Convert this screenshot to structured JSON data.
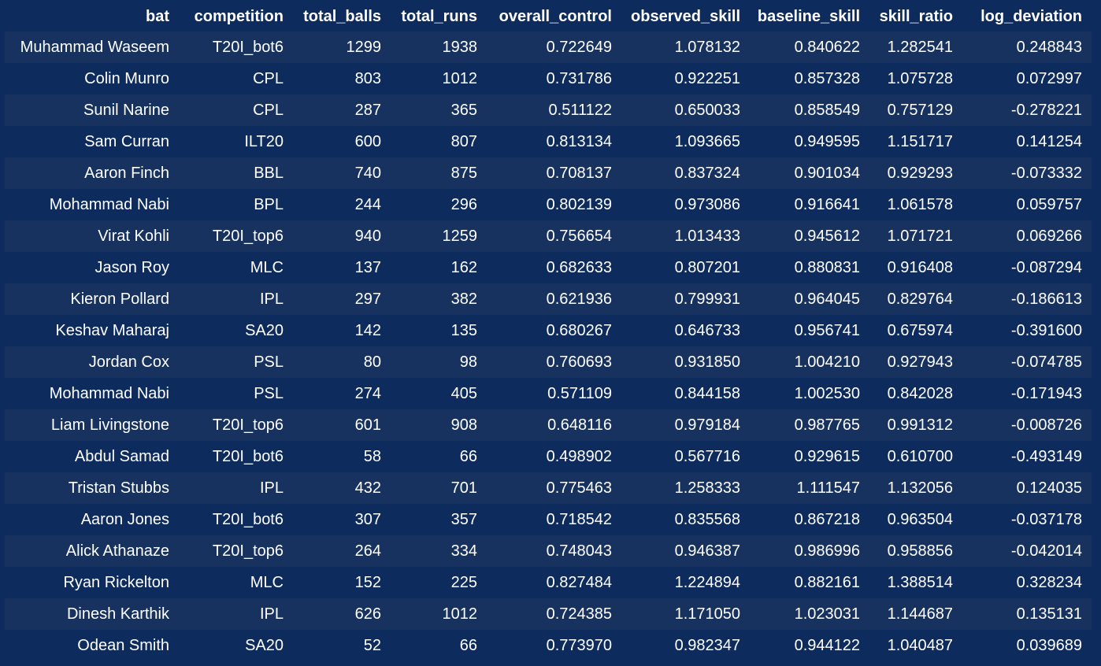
{
  "table": {
    "columns": [
      "bat",
      "competition",
      "total_balls",
      "total_runs",
      "overall_control",
      "observed_skill",
      "baseline_skill",
      "skill_ratio",
      "log_deviation"
    ],
    "rows": [
      [
        "Muhammad Waseem",
        "T20I_bot6",
        "1299",
        "1938",
        "0.722649",
        "1.078132",
        "0.840622",
        "1.282541",
        "0.248843"
      ],
      [
        "Colin Munro",
        "CPL",
        "803",
        "1012",
        "0.731786",
        "0.922251",
        "0.857328",
        "1.075728",
        "0.072997"
      ],
      [
        "Sunil Narine",
        "CPL",
        "287",
        "365",
        "0.511122",
        "0.650033",
        "0.858549",
        "0.757129",
        "-0.278221"
      ],
      [
        "Sam Curran",
        "ILT20",
        "600",
        "807",
        "0.813134",
        "1.093665",
        "0.949595",
        "1.151717",
        "0.141254"
      ],
      [
        "Aaron Finch",
        "BBL",
        "740",
        "875",
        "0.708137",
        "0.837324",
        "0.901034",
        "0.929293",
        "-0.073332"
      ],
      [
        "Mohammad Nabi",
        "BPL",
        "244",
        "296",
        "0.802139",
        "0.973086",
        "0.916641",
        "1.061578",
        "0.059757"
      ],
      [
        "Virat Kohli",
        "T20I_top6",
        "940",
        "1259",
        "0.756654",
        "1.013433",
        "0.945612",
        "1.071721",
        "0.069266"
      ],
      [
        "Jason Roy",
        "MLC",
        "137",
        "162",
        "0.682633",
        "0.807201",
        "0.880831",
        "0.916408",
        "-0.087294"
      ],
      [
        "Kieron Pollard",
        "IPL",
        "297",
        "382",
        "0.621936",
        "0.799931",
        "0.964045",
        "0.829764",
        "-0.186613"
      ],
      [
        "Keshav Maharaj",
        "SA20",
        "142",
        "135",
        "0.680267",
        "0.646733",
        "0.956741",
        "0.675974",
        "-0.391600"
      ],
      [
        "Jordan Cox",
        "PSL",
        "80",
        "98",
        "0.760693",
        "0.931850",
        "1.004210",
        "0.927943",
        "-0.074785"
      ],
      [
        "Mohammad Nabi",
        "PSL",
        "274",
        "405",
        "0.571109",
        "0.844158",
        "1.002530",
        "0.842028",
        "-0.171943"
      ],
      [
        "Liam Livingstone",
        "T20I_top6",
        "601",
        "908",
        "0.648116",
        "0.979184",
        "0.987765",
        "0.991312",
        "-0.008726"
      ],
      [
        "Abdul Samad",
        "T20I_bot6",
        "58",
        "66",
        "0.498902",
        "0.567716",
        "0.929615",
        "0.610700",
        "-0.493149"
      ],
      [
        "Tristan Stubbs",
        "IPL",
        "432",
        "701",
        "0.775463",
        "1.258333",
        "1.111547",
        "1.132056",
        "0.124035"
      ],
      [
        "Aaron Jones",
        "T20I_bot6",
        "307",
        "357",
        "0.718542",
        "0.835568",
        "0.867218",
        "0.963504",
        "-0.037178"
      ],
      [
        "Alick Athanaze",
        "T20I_top6",
        "264",
        "334",
        "0.748043",
        "0.946387",
        "0.986996",
        "0.958856",
        "-0.042014"
      ],
      [
        "Ryan Rickelton",
        "MLC",
        "152",
        "225",
        "0.827484",
        "1.224894",
        "0.882161",
        "1.388514",
        "0.328234"
      ],
      [
        "Dinesh Karthik",
        "IPL",
        "626",
        "1012",
        "0.724385",
        "1.171050",
        "1.023031",
        "1.144687",
        "0.135131"
      ],
      [
        "Odean Smith",
        "SA20",
        "52",
        "66",
        "0.773970",
        "0.982347",
        "0.944122",
        "1.040487",
        "0.039689"
      ]
    ]
  },
  "colors": {
    "background": "#0d2b5c",
    "row_stripe": "#17325e",
    "text": "#ffffff"
  }
}
